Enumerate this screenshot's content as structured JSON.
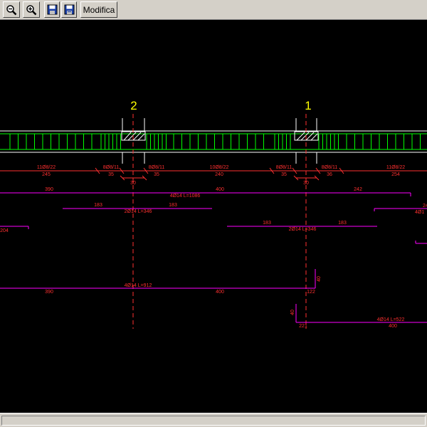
{
  "toolbar": {
    "zoom_out_icon": "zoom-out-icon",
    "zoom_in_icon": "zoom-in-icon",
    "save_icon": "save-icon",
    "save_as_icon": "save-as-icon",
    "modifica_label": "Modifica"
  },
  "drawing": {
    "axis_labels": [
      "2",
      "1"
    ],
    "stirrups": [
      {
        "text": "11Ø8/22",
        "length": "245"
      },
      {
        "text": "8Ø8/11",
        "length": "35"
      },
      {
        "text": "8Ø8/11",
        "length": "35"
      },
      {
        "text": "10Ø8/22",
        "length": "240"
      },
      {
        "text": "8Ø8/11",
        "length": "35"
      },
      {
        "text": "8Ø8/11",
        "length": "36"
      },
      {
        "text": "11Ø8/22",
        "length": "254"
      }
    ],
    "column_widths": [
      "30",
      "30"
    ],
    "bar1": {
      "label": "4Ø14 L=1086",
      "seg1": "390",
      "seg2": "400",
      "seg3": "242"
    },
    "bar2": {
      "label": "2Ø14 L=346",
      "seg1": "183",
      "seg2": "183"
    },
    "bar3": {
      "label": "2Ø14 L=346",
      "seg1": "183",
      "seg2": "183"
    },
    "bar4": {
      "label": "4Ø14 L=912",
      "seg1": "390",
      "seg2": "400",
      "seg3": "122",
      "hook": "40"
    },
    "bar5": {
      "label": "4Ø14 L=522",
      "seg1": "221",
      "seg2": "400",
      "hook": "40"
    },
    "left_fragment": "204",
    "right_fragments": [
      "24",
      "4Ø1"
    ],
    "colors": {
      "green": "#00ff00",
      "red": "#ff3030",
      "magenta": "#ff00ff",
      "yellow": "#ffff00",
      "white": "#ffffff"
    }
  }
}
